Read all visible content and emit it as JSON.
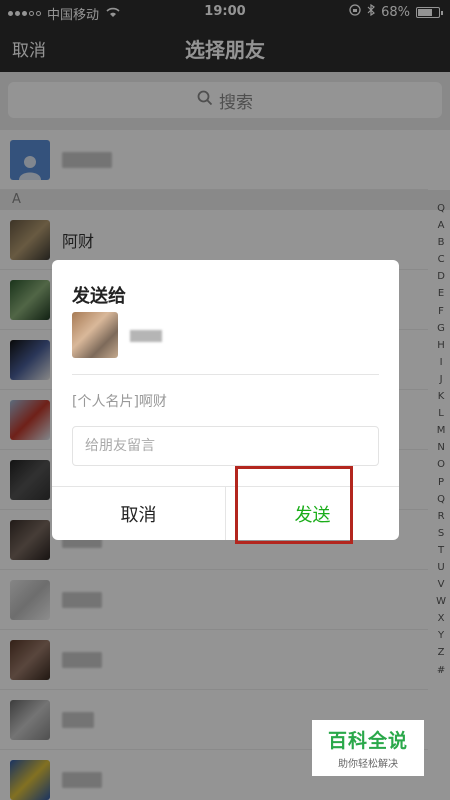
{
  "status_bar": {
    "carrier": "中国移动",
    "time": "19:00",
    "battery": "68%",
    "battery_level": 0.68
  },
  "nav": {
    "cancel_label": "取消",
    "title": "选择朋友"
  },
  "search": {
    "label": "搜索"
  },
  "list": {
    "section_header": "A",
    "first_contact_name": "阿财",
    "index_letters": [
      "Q",
      "A",
      "B",
      "C",
      "D",
      "E",
      "F",
      "G",
      "H",
      "I",
      "J",
      "K",
      "L",
      "M",
      "N",
      "O",
      "P",
      "Q",
      "R",
      "S",
      "T",
      "U",
      "V",
      "W",
      "X",
      "Y",
      "Z",
      "#"
    ]
  },
  "dialog": {
    "title": "发送给",
    "card_text": "[个人名片]啊财",
    "message_placeholder": "给朋友留言",
    "cancel_label": "取消",
    "send_label": "发送"
  },
  "watermark": {
    "main": "百科全说",
    "sub": "助你轻松解决"
  },
  "colors": {
    "header_bg": "#2e2e2e",
    "send_green": "#1aad19",
    "highlight_red": "#b3261e",
    "watermark_green": "#2aa84a"
  }
}
